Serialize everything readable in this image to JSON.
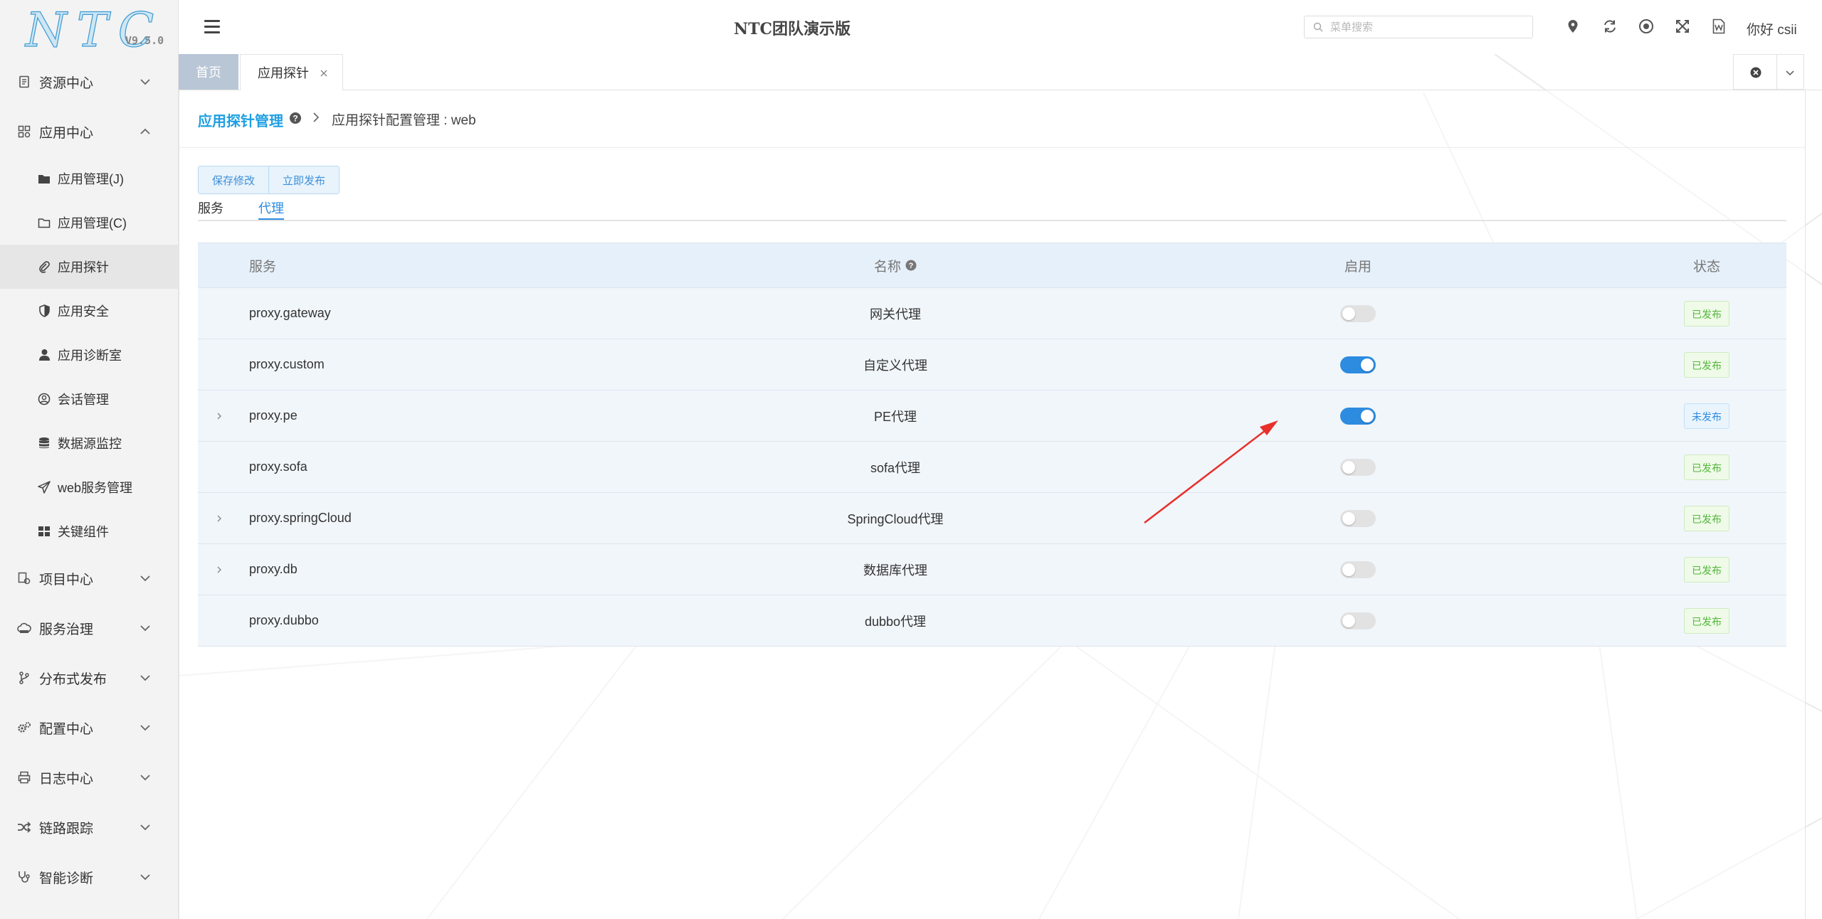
{
  "app": {
    "logo_text": "NTC",
    "version": "V9.5.0",
    "title": "NTC团队演示版"
  },
  "header": {
    "search_placeholder": "菜单搜索",
    "greeting": "你好 csii",
    "icons": [
      "location-icon",
      "refresh-icon",
      "target-icon",
      "fullscreen-icon",
      "word-doc-icon"
    ]
  },
  "sidebar": {
    "groups": [
      {
        "label": "资源中心",
        "icon": "document-icon",
        "expanded": false
      },
      {
        "label": "应用中心",
        "icon": "apps-icon",
        "expanded": true,
        "children": [
          {
            "label": "应用管理(J)",
            "icon": "folder-filled-icon"
          },
          {
            "label": "应用管理(C)",
            "icon": "folder-outline-icon"
          },
          {
            "label": "应用探针",
            "icon": "paperclip-icon",
            "active": true
          },
          {
            "label": "应用安全",
            "icon": "shield-icon"
          },
          {
            "label": "应用诊断室",
            "icon": "doctor-icon"
          },
          {
            "label": "会话管理",
            "icon": "user-circle-icon"
          },
          {
            "label": "数据源监控",
            "icon": "database-icon"
          },
          {
            "label": "web服务管理",
            "icon": "send-icon"
          },
          {
            "label": "关键组件",
            "icon": "grid-icon"
          }
        ]
      },
      {
        "label": "项目中心",
        "icon": "project-icon",
        "expanded": false
      },
      {
        "label": "服务治理",
        "icon": "cloud-icon",
        "expanded": false
      },
      {
        "label": "分布式发布",
        "icon": "branch-icon",
        "expanded": false
      },
      {
        "label": "配置中心",
        "icon": "gears-icon",
        "expanded": false
      },
      {
        "label": "日志中心",
        "icon": "print-icon",
        "expanded": false
      },
      {
        "label": "链路跟踪",
        "icon": "shuffle-icon",
        "expanded": false
      },
      {
        "label": "智能诊断",
        "icon": "stethoscope-icon",
        "expanded": false
      }
    ]
  },
  "tabs": {
    "home": "首页",
    "active": "应用探针"
  },
  "breadcrumb": {
    "main": "应用探针管理",
    "sub": "应用探针配置管理 : web"
  },
  "actions": {
    "save": "保存修改",
    "publish": "立即发布"
  },
  "subtabs": [
    {
      "label": "服务",
      "active": false
    },
    {
      "label": "代理",
      "active": true
    }
  ],
  "table": {
    "columns": {
      "service": "服务",
      "name": "名称",
      "enabled": "启用",
      "status": "状态"
    },
    "rows": [
      {
        "service": "proxy.gateway",
        "name": "网关代理",
        "enabled": false,
        "status": "已发布",
        "expandable": false
      },
      {
        "service": "proxy.custom",
        "name": "自定义代理",
        "enabled": true,
        "status": "已发布",
        "expandable": false
      },
      {
        "service": "proxy.pe",
        "name": "PE代理",
        "enabled": true,
        "status": "未发布",
        "expandable": true
      },
      {
        "service": "proxy.sofa",
        "name": "sofa代理",
        "enabled": false,
        "status": "已发布",
        "expandable": false
      },
      {
        "service": "proxy.springCloud",
        "name": "SpringCloud代理",
        "enabled": false,
        "status": "已发布",
        "expandable": true
      },
      {
        "service": "proxy.db",
        "name": "数据库代理",
        "enabled": false,
        "status": "已发布",
        "expandable": true
      },
      {
        "service": "proxy.dubbo",
        "name": "dubbo代理",
        "enabled": false,
        "status": "已发布",
        "expandable": false
      }
    ]
  },
  "colors": {
    "accent": "#2d8ce0",
    "brand_link": "#1e9fe3",
    "published": "#52b73a",
    "annotation_arrow": "#e8302a"
  }
}
